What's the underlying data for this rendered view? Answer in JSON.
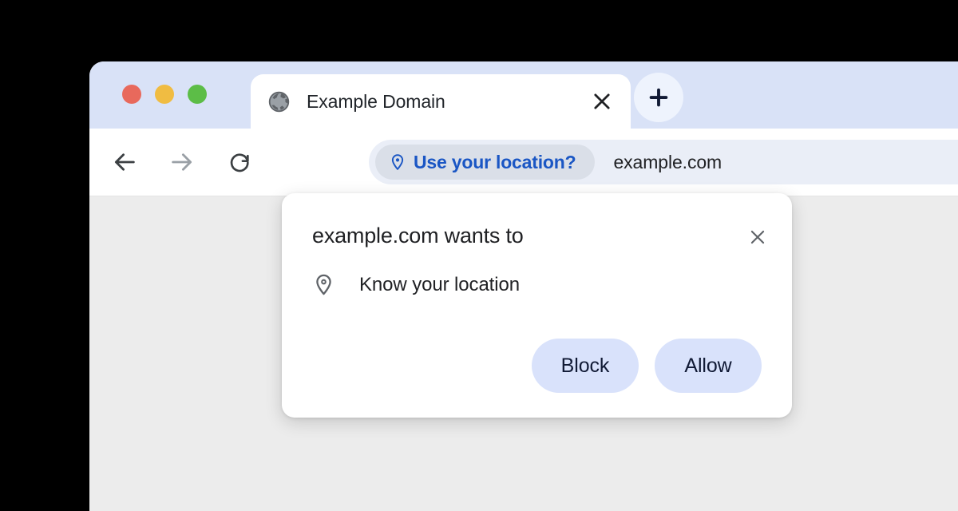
{
  "window": {
    "traffic_lights": [
      {
        "name": "close",
        "color": "#e8695c"
      },
      {
        "name": "minimize",
        "color": "#f0bc42"
      },
      {
        "name": "zoom",
        "color": "#5cbd47"
      }
    ]
  },
  "tab_strip": {
    "tabs": [
      {
        "title": "Example Domain",
        "favicon": "globe-icon",
        "close_icon": "close-icon",
        "active": true
      }
    ],
    "new_tab_icon": "plus-icon"
  },
  "toolbar": {
    "back_icon": "arrow-left-icon",
    "forward_icon": "arrow-right-icon",
    "reload_icon": "reload-icon",
    "omnibox": {
      "chip": {
        "icon": "location-pin-icon",
        "label": "Use your location?",
        "color": "#1a56c4",
        "background": "#dadfe8"
      },
      "url": "example.com"
    }
  },
  "permission_dialog": {
    "title": "example.com wants to",
    "close_icon": "close-icon",
    "permission": {
      "icon": "location-pin-icon",
      "label": "Know your location"
    },
    "buttons": [
      {
        "label": "Block",
        "name": "block-button"
      },
      {
        "label": "Allow",
        "name": "allow-button"
      }
    ],
    "button_background": "#d9e2fb",
    "button_text_color": "#111a35"
  },
  "page": {
    "background": "#ececec"
  }
}
